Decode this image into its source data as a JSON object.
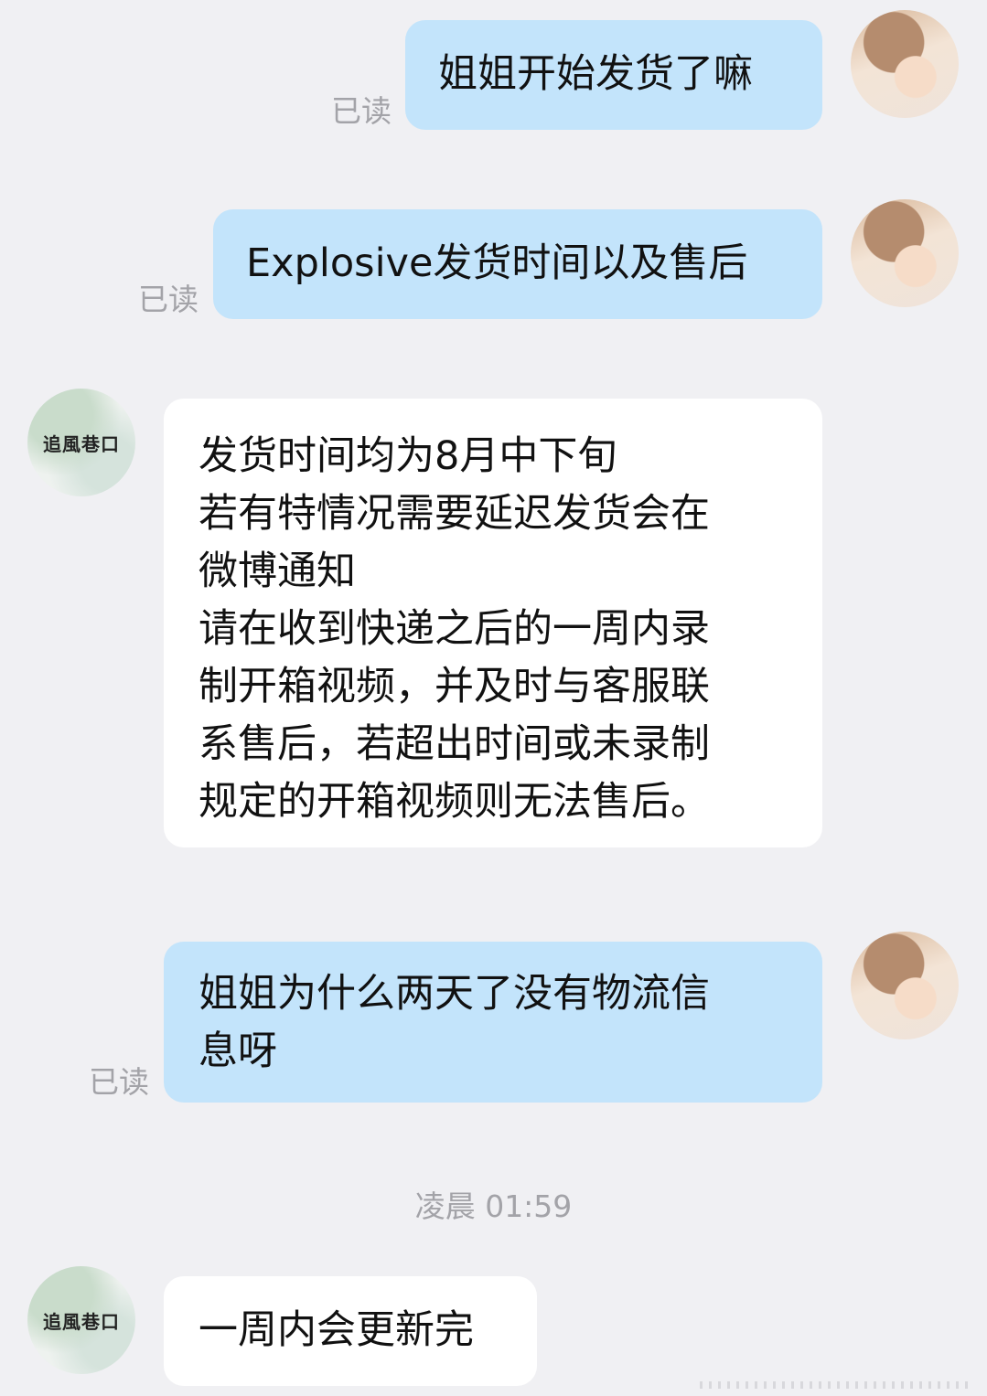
{
  "messages": [
    {
      "side": "sent",
      "text": "姐姐开始发货了嘛",
      "status": "已读"
    },
    {
      "side": "sent",
      "text": "Explosive发货时间以及售后",
      "status": "已读"
    },
    {
      "side": "received",
      "text": "发货时间均为8月中下旬\n若有特情况需要延迟发货会在\n微博通知\n请在收到快递之后的一周内录\n制开箱视频，并及时与客服联\n系售后，若超出时间或未录制\n规定的开箱视频则无法售后。"
    },
    {
      "side": "sent",
      "text": "姐姐为什么两天了没有物流信\n息呀",
      "status": "已读"
    },
    {
      "side": "received",
      "text": "一周内会更新完"
    }
  ],
  "timestamp": "凌晨 01:59",
  "shop_avatar_text": "追風巷口",
  "self_avatar_icon": "user-photo-avatar"
}
